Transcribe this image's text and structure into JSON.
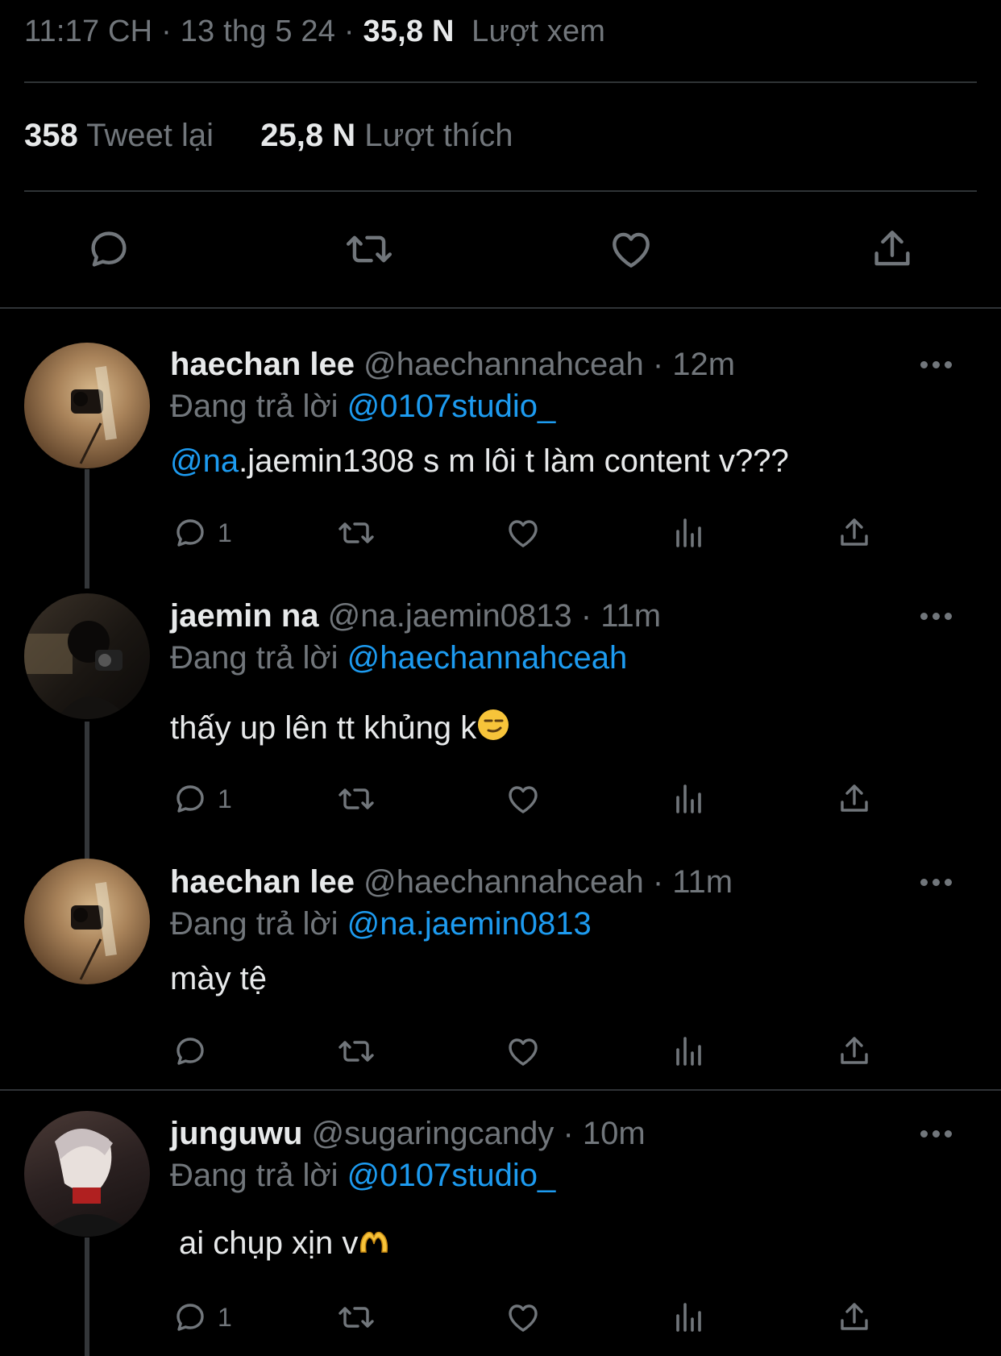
{
  "tweet_meta": {
    "time": "11:17 CH",
    "sep1": "·",
    "date": "13 thg 5 24",
    "sep2": "·",
    "views_count": "35,8 N",
    "views_label": "Lượt xem"
  },
  "tweet_stats": {
    "retweets_count": "358",
    "retweets_label": "Tweet lại",
    "likes_count": "25,8 N",
    "likes_label": "Lượt thích"
  },
  "main_actions": [
    "reply-icon",
    "retweet-icon",
    "like-icon",
    "share-icon"
  ],
  "colors": {
    "background": "#000000",
    "text": "#e7e9ea",
    "muted": "#71767b",
    "accent": "#1d9bf0",
    "divider": "#2f3336"
  },
  "replies": [
    {
      "name": "haechan lee",
      "handle": "@haechannahceah",
      "time": "· 12m",
      "replying_label": "Đang trả lời",
      "replying_to": "@0107studio_",
      "text_mention": "@na",
      "text": ".jaemin1308 s m lôi t làm content v???",
      "reply_count": "1"
    },
    {
      "name": "jaemin na",
      "handle": "@na.jaemin0813",
      "time": "· 11m",
      "replying_label": "Đang trả lời",
      "replying_to": "@haechannahceah",
      "text": "thấy up lên tt khủng k",
      "reply_count": "1"
    },
    {
      "name": "haechan lee",
      "handle": "@haechannahceah",
      "time": "· 11m",
      "replying_label": "Đang trả lời",
      "replying_to": "@na.jaemin0813",
      "text": "mày tệ",
      "reply_count": ""
    },
    {
      "name": "junguwu",
      "handle": "@sugaringcandy",
      "time": "· 10m",
      "replying_label": "Đang trả lời",
      "replying_to": "@0107studio_",
      "text": "ai chụp xịn v",
      "reply_count": "1"
    }
  ]
}
